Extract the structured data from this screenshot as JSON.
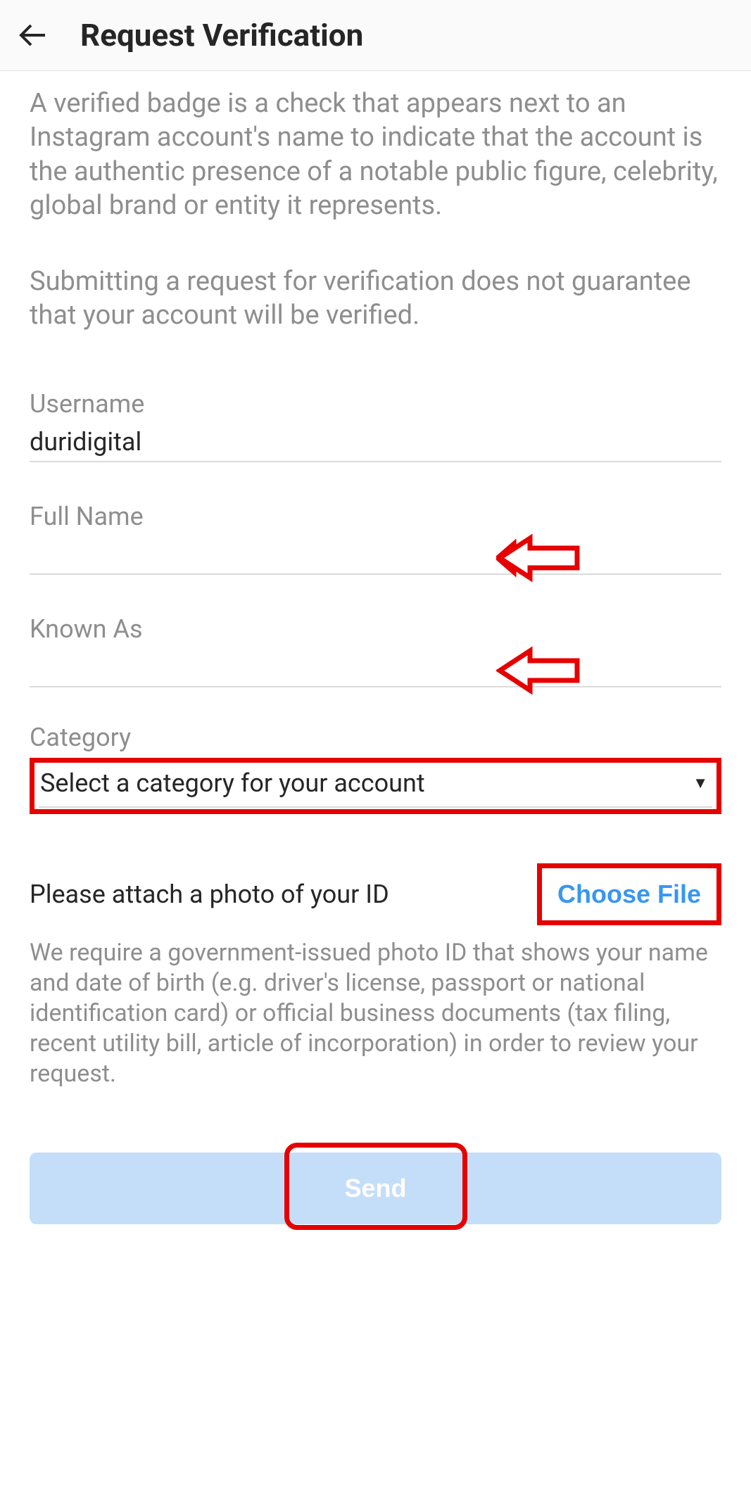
{
  "header": {
    "title": "Request Verification"
  },
  "intro": {
    "paragraph1": "A verified badge is a check that appears next to an Instagram account's name to indicate that the account is the authentic presence of a notable public figure, celebrity, global brand or entity it represents.",
    "paragraph2": "Submitting a request for verification does not guarantee that your account will be verified."
  },
  "fields": {
    "username": {
      "label": "Username",
      "value": "duridigital"
    },
    "fullname": {
      "label": "Full Name",
      "value": ""
    },
    "knownas": {
      "label": "Known As",
      "value": ""
    },
    "category": {
      "label": "Category",
      "placeholder": "Select a category for your account"
    }
  },
  "attach": {
    "label": "Please attach a photo of your ID",
    "button": "Choose File",
    "description": "We require a government-issued photo ID that shows your name and date of birth (e.g. driver's license, passport or national identification card) or official business documents (tax filing, recent utility bill, article of incorporation) in order to review your request."
  },
  "actions": {
    "send": "Send"
  }
}
